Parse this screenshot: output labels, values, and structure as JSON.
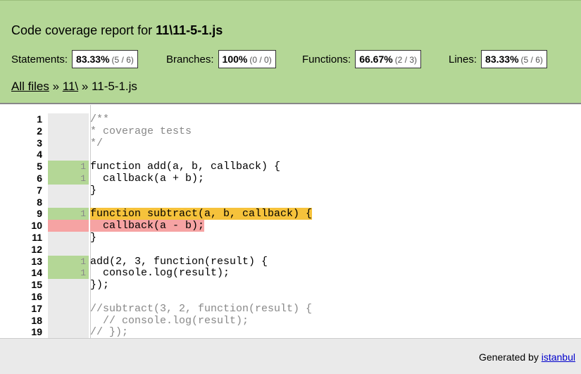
{
  "header": {
    "title_prefix": "Code coverage report for ",
    "title_file": "11\\11-5-1.js",
    "stats": [
      {
        "label": "Statements:",
        "pct": "83.33%",
        "frac": "(5 / 6)"
      },
      {
        "label": "Branches:",
        "pct": "100%",
        "frac": "(0 / 0)"
      },
      {
        "label": "Functions:",
        "pct": "66.67%",
        "frac": "(2 / 3)"
      },
      {
        "label": "Lines:",
        "pct": "83.33%",
        "frac": "(5 / 6)"
      }
    ],
    "breadcrumb": {
      "all_files": "All files",
      "sep1": " » ",
      "dir": "11\\",
      "sep2": " » ",
      "current": "11-5-1.js"
    }
  },
  "code_lines": [
    {
      "n": "1",
      "count": "",
      "text": "/**",
      "status": "neutral"
    },
    {
      "n": "2",
      "count": "",
      "text": "* coverage tests",
      "status": "neutral"
    },
    {
      "n": "3",
      "count": "",
      "text": "*/",
      "status": "neutral"
    },
    {
      "n": "4",
      "count": "",
      "text": "",
      "status": "neutral"
    },
    {
      "n": "5",
      "count": "1",
      "text": "function add(a, b, callback) {",
      "status": "hit"
    },
    {
      "n": "6",
      "count": "1",
      "text": "  callback(a + b);",
      "status": "hit"
    },
    {
      "n": "7",
      "count": "",
      "text": "}",
      "status": "neutral"
    },
    {
      "n": "8",
      "count": "",
      "text": "",
      "status": "neutral"
    },
    {
      "n": "9",
      "count": "1",
      "text": "function subtract(a, b, callback) {",
      "status": "fn-miss"
    },
    {
      "n": "10",
      "count": "",
      "text": "  callback(a - b);",
      "status": "miss"
    },
    {
      "n": "11",
      "count": "",
      "text": "}",
      "status": "neutral"
    },
    {
      "n": "12",
      "count": "",
      "text": "",
      "status": "neutral"
    },
    {
      "n": "13",
      "count": "1",
      "text": "add(2, 3, function(result) {",
      "status": "hit"
    },
    {
      "n": "14",
      "count": "1",
      "text": "  console.log(result);",
      "status": "hit"
    },
    {
      "n": "15",
      "count": "",
      "text": "});",
      "status": "neutral"
    },
    {
      "n": "16",
      "count": "",
      "text": "",
      "status": "neutral"
    },
    {
      "n": "17",
      "count": "",
      "text": "//subtract(3, 2, function(result) {",
      "status": "neutral"
    },
    {
      "n": "18",
      "count": "",
      "text": "  // console.log(result);",
      "status": "neutral"
    },
    {
      "n": "19",
      "count": "",
      "text": "// });",
      "status": "neutral"
    }
  ],
  "footer": {
    "generated_by": "Generated by ",
    "tool": "istanbul"
  },
  "colors": {
    "header_bg": "#b4d796",
    "hit": "#b4d796",
    "miss": "#f6a3a3",
    "fn_miss": "#f6c23b"
  }
}
